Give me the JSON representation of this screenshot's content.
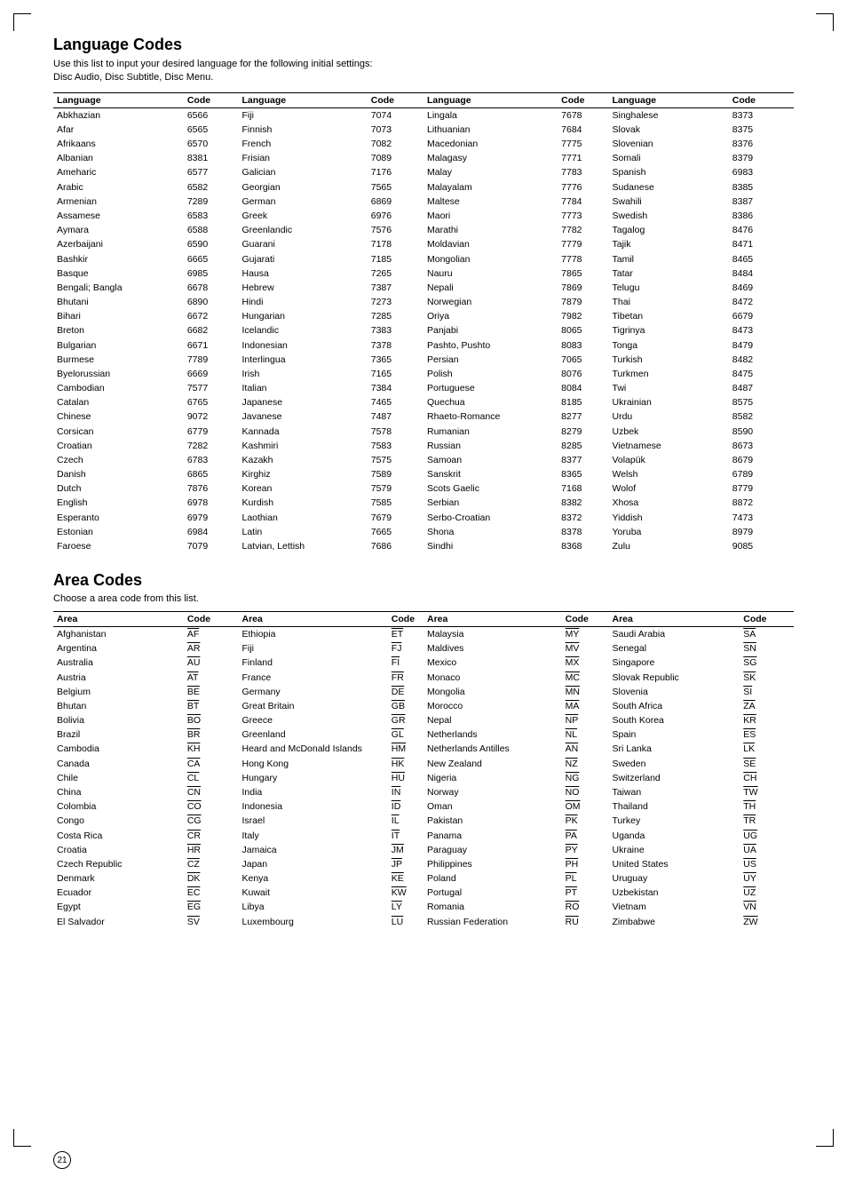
{
  "language_section": {
    "title": "Language Codes",
    "subtitle_line1": "Use this list to input your desired language for the following initial settings:",
    "subtitle_line2": "Disc Audio, Disc Subtitle, Disc Menu.",
    "columns": [
      {
        "header_lang": "Language",
        "header_code": "Code",
        "rows": [
          [
            "Abkhazian",
            "6566"
          ],
          [
            "Afar",
            "6565"
          ],
          [
            "Afrikaans",
            "6570"
          ],
          [
            "Albanian",
            "8381"
          ],
          [
            "Ameharic",
            "6577"
          ],
          [
            "Arabic",
            "6582"
          ],
          [
            "Armenian",
            "7289"
          ],
          [
            "Assamese",
            "6583"
          ],
          [
            "Aymara",
            "6588"
          ],
          [
            "Azerbaijani",
            "6590"
          ],
          [
            "Bashkir",
            "6665"
          ],
          [
            "Basque",
            "6985"
          ],
          [
            "Bengali; Bangla",
            "6678"
          ],
          [
            "Bhutani",
            "6890"
          ],
          [
            "Bihari",
            "6672"
          ],
          [
            "Breton",
            "6682"
          ],
          [
            "Bulgarian",
            "6671"
          ],
          [
            "Burmese",
            "7789"
          ],
          [
            "Byelorussian",
            "6669"
          ],
          [
            "Cambodian",
            "7577"
          ],
          [
            "Catalan",
            "6765"
          ],
          [
            "Chinese",
            "9072"
          ],
          [
            "Corsican",
            "6779"
          ],
          [
            "Croatian",
            "7282"
          ],
          [
            "Czech",
            "6783"
          ],
          [
            "Danish",
            "6865"
          ],
          [
            "Dutch",
            "7876"
          ],
          [
            "English",
            "6978"
          ],
          [
            "Esperanto",
            "6979"
          ],
          [
            "Estonian",
            "6984"
          ],
          [
            "Faroese",
            "7079"
          ]
        ]
      },
      {
        "header_lang": "Language",
        "header_code": "Code",
        "rows": [
          [
            "Fiji",
            "7074"
          ],
          [
            "Finnish",
            "7073"
          ],
          [
            "French",
            "7082"
          ],
          [
            "Frisian",
            "7089"
          ],
          [
            "Galician",
            "7176"
          ],
          [
            "Georgian",
            "7565"
          ],
          [
            "German",
            "6869"
          ],
          [
            "Greek",
            "6976"
          ],
          [
            "Greenlandic",
            "7576"
          ],
          [
            "Guarani",
            "7178"
          ],
          [
            "Gujarati",
            "7185"
          ],
          [
            "Hausa",
            "7265"
          ],
          [
            "Hebrew",
            "7387"
          ],
          [
            "Hindi",
            "7273"
          ],
          [
            "Hungarian",
            "7285"
          ],
          [
            "Icelandic",
            "7383"
          ],
          [
            "Indonesian",
            "7378"
          ],
          [
            "Interlingua",
            "7365"
          ],
          [
            "Irish",
            "7165"
          ],
          [
            "Italian",
            "7384"
          ],
          [
            "Japanese",
            "7465"
          ],
          [
            "Javanese",
            "7487"
          ],
          [
            "Kannada",
            "7578"
          ],
          [
            "Kashmiri",
            "7583"
          ],
          [
            "Kazakh",
            "7575"
          ],
          [
            "Kirghiz",
            "7589"
          ],
          [
            "Korean",
            "7579"
          ],
          [
            "Kurdish",
            "7585"
          ],
          [
            "Laothian",
            "7679"
          ],
          [
            "Latin",
            "7665"
          ],
          [
            "Latvian, Lettish",
            "7686"
          ]
        ]
      },
      {
        "header_lang": "Language",
        "header_code": "Code",
        "rows": [
          [
            "Lingala",
            "7678"
          ],
          [
            "Lithuanian",
            "7684"
          ],
          [
            "Macedonian",
            "7775"
          ],
          [
            "Malagasy",
            "7771"
          ],
          [
            "Malay",
            "7783"
          ],
          [
            "Malayalam",
            "7776"
          ],
          [
            "Maltese",
            "7784"
          ],
          [
            "Maori",
            "7773"
          ],
          [
            "Marathi",
            "7782"
          ],
          [
            "Moldavian",
            "7779"
          ],
          [
            "Mongolian",
            "7778"
          ],
          [
            "Nauru",
            "7865"
          ],
          [
            "Nepali",
            "7869"
          ],
          [
            "Norwegian",
            "7879"
          ],
          [
            "Oriya",
            "7982"
          ],
          [
            "Panjabi",
            "8065"
          ],
          [
            "Pashto, Pushto",
            "8083"
          ],
          [
            "Persian",
            "7065"
          ],
          [
            "Polish",
            "8076"
          ],
          [
            "Portuguese",
            "8084"
          ],
          [
            "Quechua",
            "8185"
          ],
          [
            "Rhaeto-Romance",
            "8277"
          ],
          [
            "Rumanian",
            "8279"
          ],
          [
            "Russian",
            "8285"
          ],
          [
            "Samoan",
            "8377"
          ],
          [
            "Sanskrit",
            "8365"
          ],
          [
            "Scots Gaelic",
            "7168"
          ],
          [
            "Serbian",
            "8382"
          ],
          [
            "Serbo-Croatian",
            "8372"
          ],
          [
            "Shona",
            "8378"
          ],
          [
            "Sindhi",
            "8368"
          ]
        ]
      },
      {
        "header_lang": "Language",
        "header_code": "Code",
        "rows": [
          [
            "Singhalese",
            "8373"
          ],
          [
            "Slovak",
            "8375"
          ],
          [
            "Slovenian",
            "8376"
          ],
          [
            "Somali",
            "8379"
          ],
          [
            "Spanish",
            "6983"
          ],
          [
            "Sudanese",
            "8385"
          ],
          [
            "Swahili",
            "8387"
          ],
          [
            "Swedish",
            "8386"
          ],
          [
            "Tagalog",
            "8476"
          ],
          [
            "Tajik",
            "8471"
          ],
          [
            "Tamil",
            "8465"
          ],
          [
            "Tatar",
            "8484"
          ],
          [
            "Telugu",
            "8469"
          ],
          [
            "Thai",
            "8472"
          ],
          [
            "Tibetan",
            "6679"
          ],
          [
            "Tigrinya",
            "8473"
          ],
          [
            "Tonga",
            "8479"
          ],
          [
            "Turkish",
            "8482"
          ],
          [
            "Turkmen",
            "8475"
          ],
          [
            "Twi",
            "8487"
          ],
          [
            "Ukrainian",
            "8575"
          ],
          [
            "Urdu",
            "8582"
          ],
          [
            "Uzbek",
            "8590"
          ],
          [
            "Vietnamese",
            "8673"
          ],
          [
            "Volapük",
            "8679"
          ],
          [
            "Welsh",
            "6789"
          ],
          [
            "Wolof",
            "8779"
          ],
          [
            "Xhosa",
            "8872"
          ],
          [
            "Yiddish",
            "7473"
          ],
          [
            "Yoruba",
            "8979"
          ],
          [
            "Zulu",
            "9085"
          ]
        ]
      }
    ]
  },
  "area_section": {
    "title": "Area Codes",
    "subtitle": "Choose a area code from this list.",
    "columns": [
      {
        "header_area": "Area",
        "header_code": "Code",
        "rows": [
          [
            "Afghanistan",
            "AF"
          ],
          [
            "Argentina",
            "AR"
          ],
          [
            "Australia",
            "AU"
          ],
          [
            "Austria",
            "AT"
          ],
          [
            "Belgium",
            "BE"
          ],
          [
            "Bhutan",
            "BT"
          ],
          [
            "Bolivia",
            "BO"
          ],
          [
            "Brazil",
            "BR"
          ],
          [
            "Cambodia",
            "KH"
          ],
          [
            "Canada",
            "CA"
          ],
          [
            "Chile",
            "CL"
          ],
          [
            "China",
            "CN"
          ],
          [
            "Colombia",
            "CO"
          ],
          [
            "Congo",
            "CG"
          ],
          [
            "Costa Rica",
            "CR"
          ],
          [
            "Croatia",
            "HR"
          ],
          [
            "Czech Republic",
            "CZ"
          ],
          [
            "Denmark",
            "DK"
          ],
          [
            "Ecuador",
            "EC"
          ],
          [
            "Egypt",
            "EG"
          ],
          [
            "El Salvador",
            "SV"
          ]
        ]
      },
      {
        "header_area": "Area",
        "header_code": "Code",
        "rows": [
          [
            "Ethiopia",
            "ET"
          ],
          [
            "Fiji",
            "FJ"
          ],
          [
            "Finland",
            "FI"
          ],
          [
            "France",
            "FR"
          ],
          [
            "Germany",
            "DE"
          ],
          [
            "Great Britain",
            "GB"
          ],
          [
            "Greece",
            "GR"
          ],
          [
            "Greenland",
            "GL"
          ],
          [
            "Heard and McDonald Islands",
            "HM"
          ],
          [
            "Hong Kong",
            "HK"
          ],
          [
            "Hungary",
            "HU"
          ],
          [
            "India",
            "IN"
          ],
          [
            "Indonesia",
            "ID"
          ],
          [
            "Israel",
            "IL"
          ],
          [
            "Italy",
            "IT"
          ],
          [
            "Jamaica",
            "JM"
          ],
          [
            "Japan",
            "JP"
          ],
          [
            "Kenya",
            "KE"
          ],
          [
            "Kuwait",
            "KW"
          ],
          [
            "Libya",
            "LY"
          ],
          [
            "Luxembourg",
            "LU"
          ]
        ]
      },
      {
        "header_area": "Area",
        "header_code": "Code",
        "rows": [
          [
            "Malaysia",
            "MY"
          ],
          [
            "Maldives",
            "MV"
          ],
          [
            "Mexico",
            "MX"
          ],
          [
            "Monaco",
            "MC"
          ],
          [
            "Mongolia",
            "MN"
          ],
          [
            "Morocco",
            "MA"
          ],
          [
            "Nepal",
            "NP"
          ],
          [
            "Netherlands",
            "NL"
          ],
          [
            "Netherlands Antilles",
            "AN"
          ],
          [
            "New Zealand",
            "NZ"
          ],
          [
            "Nigeria",
            "NG"
          ],
          [
            "Norway",
            "NO"
          ],
          [
            "Oman",
            "OM"
          ],
          [
            "Pakistan",
            "PK"
          ],
          [
            "Panama",
            "PA"
          ],
          [
            "Paraguay",
            "PY"
          ],
          [
            "Philippines",
            "PH"
          ],
          [
            "Poland",
            "PL"
          ],
          [
            "Portugal",
            "PT"
          ],
          [
            "Romania",
            "RO"
          ],
          [
            "Russian Federation",
            "RU"
          ]
        ]
      },
      {
        "header_area": "Area",
        "header_code": "Code",
        "rows": [
          [
            "Saudi Arabia",
            "SA"
          ],
          [
            "Senegal",
            "SN"
          ],
          [
            "Singapore",
            "SG"
          ],
          [
            "Slovak Republic",
            "SK"
          ],
          [
            "Slovenia",
            "SI"
          ],
          [
            "South Africa",
            "ZA"
          ],
          [
            "South Korea",
            "KR"
          ],
          [
            "Spain",
            "ES"
          ],
          [
            "Sri Lanka",
            "LK"
          ],
          [
            "Sweden",
            "SE"
          ],
          [
            "Switzerland",
            "CH"
          ],
          [
            "Taiwan",
            "TW"
          ],
          [
            "Thailand",
            "TH"
          ],
          [
            "Turkey",
            "TR"
          ],
          [
            "Uganda",
            "UG"
          ],
          [
            "Ukraine",
            "UA"
          ],
          [
            "United States",
            "US"
          ],
          [
            "Uruguay",
            "UY"
          ],
          [
            "Uzbekistan",
            "UZ"
          ],
          [
            "Vietnam",
            "VN"
          ],
          [
            "Zimbabwe",
            "ZW"
          ]
        ]
      }
    ]
  },
  "page_number": "21"
}
